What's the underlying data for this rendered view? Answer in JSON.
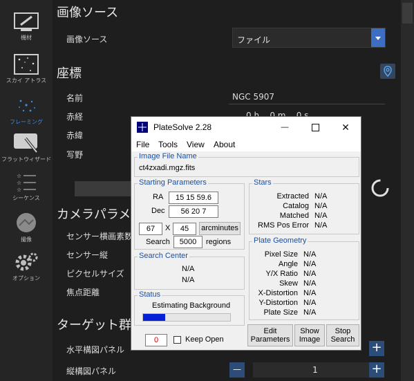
{
  "sidebar": {
    "items": [
      {
        "label": "機材"
      },
      {
        "label": "スカイ アトラス"
      },
      {
        "label": "フレーミング"
      },
      {
        "label": "フラットウィザード"
      },
      {
        "label": "シーケンス"
      },
      {
        "label": "撮像"
      },
      {
        "label": "オプション"
      }
    ]
  },
  "image_source": {
    "heading": "画像ソース",
    "label": "画像ソース",
    "value": "ファイル"
  },
  "coords": {
    "heading": "座標",
    "name_label": "名前",
    "name_value": "NGC 5907",
    "ra_label": "赤経",
    "ra_value": "0 h    0 m    0 s",
    "dec_label": "赤緯",
    "fov_label": "写野"
  },
  "camera": {
    "heading": "カメラパラメータ",
    "sensor_w": "センサー横画素数",
    "sensor_h": "センサー縦",
    "pixel": "ピクセルサイズ",
    "focal": "焦点距離"
  },
  "target": {
    "heading": "ターゲット群",
    "h_panels": "水平構図パネル",
    "v_panels": "縦構図パネル",
    "v_value": "1",
    "plus": "+",
    "minus": "—"
  },
  "dialog": {
    "title": "PlateSolve 2.28",
    "minimize": "—",
    "close": "✕",
    "menu": [
      "File",
      "Tools",
      "View",
      "About"
    ],
    "image_file_caption": "Image File Name",
    "image_file": "ct4zxadi.mgz.fits",
    "start_caption": "Starting Parameters",
    "ra_label": "RA",
    "ra_value": "15 15 59.6",
    "dec_label": "Dec",
    "dec_value": "56 20 7",
    "fov_w": "67",
    "x": "X",
    "fov_h": "45",
    "units_btn": "arcminutes",
    "search_label": "Search",
    "search_value": "5000",
    "regions": "regions",
    "search_center_caption": "Search Center",
    "sc_ra": "N/A",
    "sc_dec": "N/A",
    "status_caption": "Status",
    "status_text": "Estimating Background",
    "progress": 0.25,
    "counter": "0",
    "keep_open": "Keep Open",
    "stars_caption": "Stars",
    "stars": [
      {
        "k": "Extracted",
        "v": "N/A"
      },
      {
        "k": "Catalog",
        "v": "N/A"
      },
      {
        "k": "Matched",
        "v": "N/A"
      },
      {
        "k": "RMS Pos Error",
        "v": "N/A"
      }
    ],
    "geom_caption": "Plate Geometry",
    "geom": [
      {
        "k": "Pixel Size",
        "v": "N/A"
      },
      {
        "k": "Angle",
        "v": "N/A"
      },
      {
        "k": "Y/X Ratio",
        "v": "N/A"
      },
      {
        "k": "Skew",
        "v": "N/A"
      },
      {
        "k": "X-Distortion",
        "v": "N/A"
      },
      {
        "k": "Y-Distortion",
        "v": "N/A"
      },
      {
        "k": "Plate Size",
        "v": "N/A"
      }
    ],
    "edit_btn": [
      "Edit",
      "Parameters"
    ],
    "show_btn": [
      "Show",
      "Image"
    ],
    "stop_btn": [
      "Stop",
      "Search"
    ]
  }
}
